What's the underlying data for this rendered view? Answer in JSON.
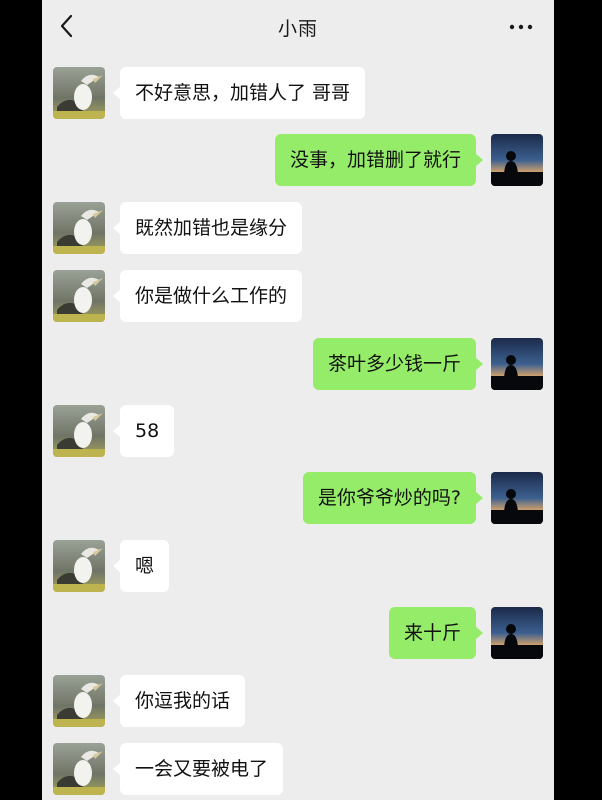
{
  "header": {
    "title": "小雨",
    "back_icon": "chevron-left-icon",
    "more_icon": "more-dots-icon"
  },
  "colors": {
    "background": "#ededed",
    "incoming_bubble": "#ffffff",
    "outgoing_bubble": "#95ec69",
    "text": "#111111"
  },
  "messages": [
    {
      "sender": "contact",
      "text": "不好意思，加错人了 哥哥"
    },
    {
      "sender": "me",
      "text": "没事，加错删了就行"
    },
    {
      "sender": "contact",
      "text": "既然加错也是缘分"
    },
    {
      "sender": "contact",
      "text": "你是做什么工作的"
    },
    {
      "sender": "me",
      "text": "茶叶多少钱一斤"
    },
    {
      "sender": "contact",
      "text": "58"
    },
    {
      "sender": "me",
      "text": "是你爷爷炒的吗?"
    },
    {
      "sender": "contact",
      "text": "嗯"
    },
    {
      "sender": "me",
      "text": "来十斤"
    },
    {
      "sender": "contact",
      "text": "你逗我的话"
    },
    {
      "sender": "contact",
      "text": "一会又要被电了"
    }
  ]
}
